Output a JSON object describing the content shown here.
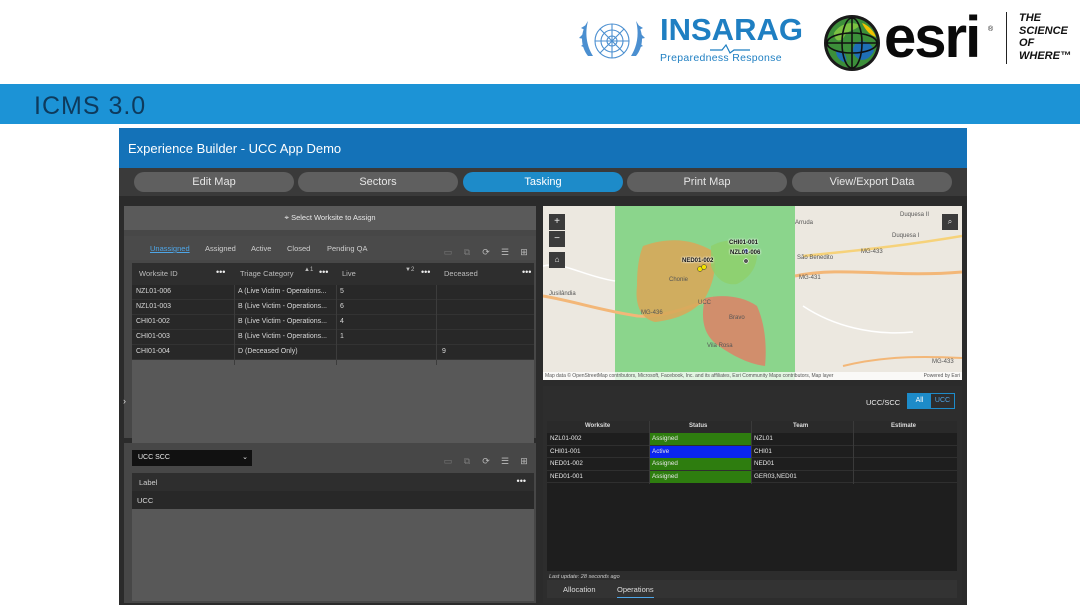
{
  "logos": {
    "insarag_title": "INSARAG",
    "insarag_tagline": "Preparedness   Response",
    "esri_word": "esri",
    "esri_reg": "®",
    "esri_slogan": [
      "THE",
      "SCIENCE",
      "OF",
      "WHERE™"
    ]
  },
  "band": {
    "title": "ICMS 3.0"
  },
  "app": {
    "title": "Experience Builder - UCC App Demo",
    "nav": [
      "Edit Map",
      "Sectors",
      "Tasking",
      "Print Map",
      "View/Export Data"
    ],
    "active_nav": "Tasking"
  },
  "assign": {
    "select_label": "Select Worksite to Assign",
    "tabs": [
      "Unassigned",
      "Assigned",
      "Active",
      "Closed",
      "Pending QA"
    ],
    "active_tab": "Unassigned",
    "columns": [
      "Worksite ID",
      "Triage Category",
      "Live",
      "Deceased"
    ],
    "sort_badges": [
      "1",
      "2"
    ],
    "rows": [
      {
        "worksite": "NZL01-006",
        "triage": "A (Live Victim - Operations...",
        "live": "5",
        "deceased": ""
      },
      {
        "worksite": "NZL01-003",
        "triage": "B (Live Victim - Operations...",
        "live": "6",
        "deceased": ""
      },
      {
        "worksite": "CHI01-002",
        "triage": "B (Live Victim - Operations...",
        "live": "4",
        "deceased": ""
      },
      {
        "worksite": "CHI01-003",
        "triage": "B (Live Victim - Operations...",
        "live": "1",
        "deceased": ""
      },
      {
        "worksite": "CHI01-004",
        "triage": "D (Deceased Only)",
        "live": "",
        "deceased": "9"
      }
    ]
  },
  "ucc_list": {
    "dropdown_value": "UCC SCC",
    "column": "Label",
    "rows": [
      "UCC"
    ]
  },
  "map": {
    "labels": {
      "duqueso_ii": "Duquesa II",
      "duqueso_i": "Duquesa I",
      "sao_benedito": "São Benedito",
      "jusilandia": "Jusilândia",
      "chonie": "Chonie",
      "ucc": "UCC",
      "bravo": "Bravo",
      "vila": "Vila Rosa",
      "arruda": "Arruda",
      "mg433": "MG-433",
      "mg431": "MG-431",
      "mg433b": "MG-433",
      "mg436": "MG-436"
    },
    "worksite_labels": [
      "CHI01-001",
      "NZL01-006",
      "NED01-002"
    ],
    "attribution": "Map data © OpenStreetMap contributors, Microsoft, Facebook, Inc. and its affiliates, Esri Community Maps contributors, Map layer",
    "powered": "Powered by Esri"
  },
  "operations": {
    "filter_label": "UCC/SCC",
    "filter_options": [
      "All",
      "UCC"
    ],
    "filter_selected": "All",
    "columns": [
      "Worksite",
      "Status",
      "Team",
      "Estimate"
    ],
    "rows": [
      {
        "worksite": "NZL01-002",
        "status": "Assigned",
        "status_color": "#2e7d0f",
        "team": "NZL01",
        "estimate": ""
      },
      {
        "worksite": "CHI01-001",
        "status": "Active",
        "status_color": "#0a25f0",
        "team": "CHI01",
        "estimate": ""
      },
      {
        "worksite": "NED01-002",
        "status": "Assigned",
        "status_color": "#2e7d0f",
        "team": "NED01",
        "estimate": ""
      },
      {
        "worksite": "NED01-001",
        "status": "Assigned",
        "status_color": "#2e7d0f",
        "team": "GER03,NED01",
        "estimate": ""
      }
    ],
    "last_update": "Last update: 28 seconds ago",
    "tabs": [
      "Allocation",
      "Operations"
    ],
    "active_tab": "Operations"
  },
  "colors": {
    "band": "#1c93d6",
    "app_header": "#1472b8",
    "accent": "#1d8bc9",
    "assigned": "#2e7d0f",
    "active": "#0a25f0"
  }
}
